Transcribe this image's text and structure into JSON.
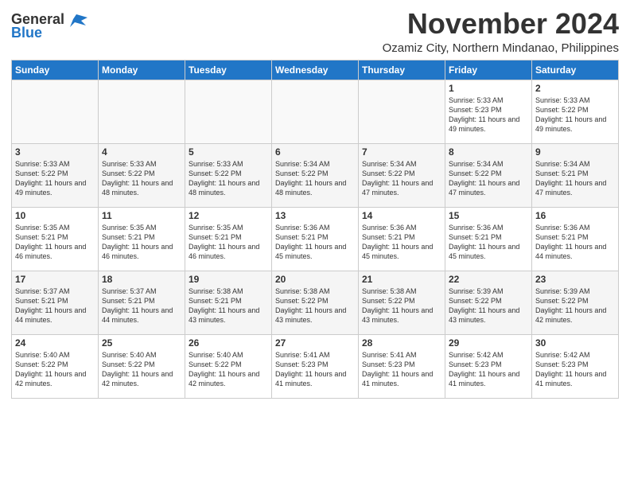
{
  "logo": {
    "general": "General",
    "blue": "Blue"
  },
  "title": "November 2024",
  "subtitle": "Ozamiz City, Northern Mindanao, Philippines",
  "days_of_week": [
    "Sunday",
    "Monday",
    "Tuesday",
    "Wednesday",
    "Thursday",
    "Friday",
    "Saturday"
  ],
  "weeks": [
    [
      {
        "day": "",
        "info": ""
      },
      {
        "day": "",
        "info": ""
      },
      {
        "day": "",
        "info": ""
      },
      {
        "day": "",
        "info": ""
      },
      {
        "day": "",
        "info": ""
      },
      {
        "day": "1",
        "info": "Sunrise: 5:33 AM\nSunset: 5:23 PM\nDaylight: 11 hours and 49 minutes."
      },
      {
        "day": "2",
        "info": "Sunrise: 5:33 AM\nSunset: 5:22 PM\nDaylight: 11 hours and 49 minutes."
      }
    ],
    [
      {
        "day": "3",
        "info": "Sunrise: 5:33 AM\nSunset: 5:22 PM\nDaylight: 11 hours and 49 minutes."
      },
      {
        "day": "4",
        "info": "Sunrise: 5:33 AM\nSunset: 5:22 PM\nDaylight: 11 hours and 48 minutes."
      },
      {
        "day": "5",
        "info": "Sunrise: 5:33 AM\nSunset: 5:22 PM\nDaylight: 11 hours and 48 minutes."
      },
      {
        "day": "6",
        "info": "Sunrise: 5:34 AM\nSunset: 5:22 PM\nDaylight: 11 hours and 48 minutes."
      },
      {
        "day": "7",
        "info": "Sunrise: 5:34 AM\nSunset: 5:22 PM\nDaylight: 11 hours and 47 minutes."
      },
      {
        "day": "8",
        "info": "Sunrise: 5:34 AM\nSunset: 5:22 PM\nDaylight: 11 hours and 47 minutes."
      },
      {
        "day": "9",
        "info": "Sunrise: 5:34 AM\nSunset: 5:21 PM\nDaylight: 11 hours and 47 minutes."
      }
    ],
    [
      {
        "day": "10",
        "info": "Sunrise: 5:35 AM\nSunset: 5:21 PM\nDaylight: 11 hours and 46 minutes."
      },
      {
        "day": "11",
        "info": "Sunrise: 5:35 AM\nSunset: 5:21 PM\nDaylight: 11 hours and 46 minutes."
      },
      {
        "day": "12",
        "info": "Sunrise: 5:35 AM\nSunset: 5:21 PM\nDaylight: 11 hours and 46 minutes."
      },
      {
        "day": "13",
        "info": "Sunrise: 5:36 AM\nSunset: 5:21 PM\nDaylight: 11 hours and 45 minutes."
      },
      {
        "day": "14",
        "info": "Sunrise: 5:36 AM\nSunset: 5:21 PM\nDaylight: 11 hours and 45 minutes."
      },
      {
        "day": "15",
        "info": "Sunrise: 5:36 AM\nSunset: 5:21 PM\nDaylight: 11 hours and 45 minutes."
      },
      {
        "day": "16",
        "info": "Sunrise: 5:36 AM\nSunset: 5:21 PM\nDaylight: 11 hours and 44 minutes."
      }
    ],
    [
      {
        "day": "17",
        "info": "Sunrise: 5:37 AM\nSunset: 5:21 PM\nDaylight: 11 hours and 44 minutes."
      },
      {
        "day": "18",
        "info": "Sunrise: 5:37 AM\nSunset: 5:21 PM\nDaylight: 11 hours and 44 minutes."
      },
      {
        "day": "19",
        "info": "Sunrise: 5:38 AM\nSunset: 5:21 PM\nDaylight: 11 hours and 43 minutes."
      },
      {
        "day": "20",
        "info": "Sunrise: 5:38 AM\nSunset: 5:22 PM\nDaylight: 11 hours and 43 minutes."
      },
      {
        "day": "21",
        "info": "Sunrise: 5:38 AM\nSunset: 5:22 PM\nDaylight: 11 hours and 43 minutes."
      },
      {
        "day": "22",
        "info": "Sunrise: 5:39 AM\nSunset: 5:22 PM\nDaylight: 11 hours and 43 minutes."
      },
      {
        "day": "23",
        "info": "Sunrise: 5:39 AM\nSunset: 5:22 PM\nDaylight: 11 hours and 42 minutes."
      }
    ],
    [
      {
        "day": "24",
        "info": "Sunrise: 5:40 AM\nSunset: 5:22 PM\nDaylight: 11 hours and 42 minutes."
      },
      {
        "day": "25",
        "info": "Sunrise: 5:40 AM\nSunset: 5:22 PM\nDaylight: 11 hours and 42 minutes."
      },
      {
        "day": "26",
        "info": "Sunrise: 5:40 AM\nSunset: 5:22 PM\nDaylight: 11 hours and 42 minutes."
      },
      {
        "day": "27",
        "info": "Sunrise: 5:41 AM\nSunset: 5:23 PM\nDaylight: 11 hours and 41 minutes."
      },
      {
        "day": "28",
        "info": "Sunrise: 5:41 AM\nSunset: 5:23 PM\nDaylight: 11 hours and 41 minutes."
      },
      {
        "day": "29",
        "info": "Sunrise: 5:42 AM\nSunset: 5:23 PM\nDaylight: 11 hours and 41 minutes."
      },
      {
        "day": "30",
        "info": "Sunrise: 5:42 AM\nSunset: 5:23 PM\nDaylight: 11 hours and 41 minutes."
      }
    ]
  ]
}
